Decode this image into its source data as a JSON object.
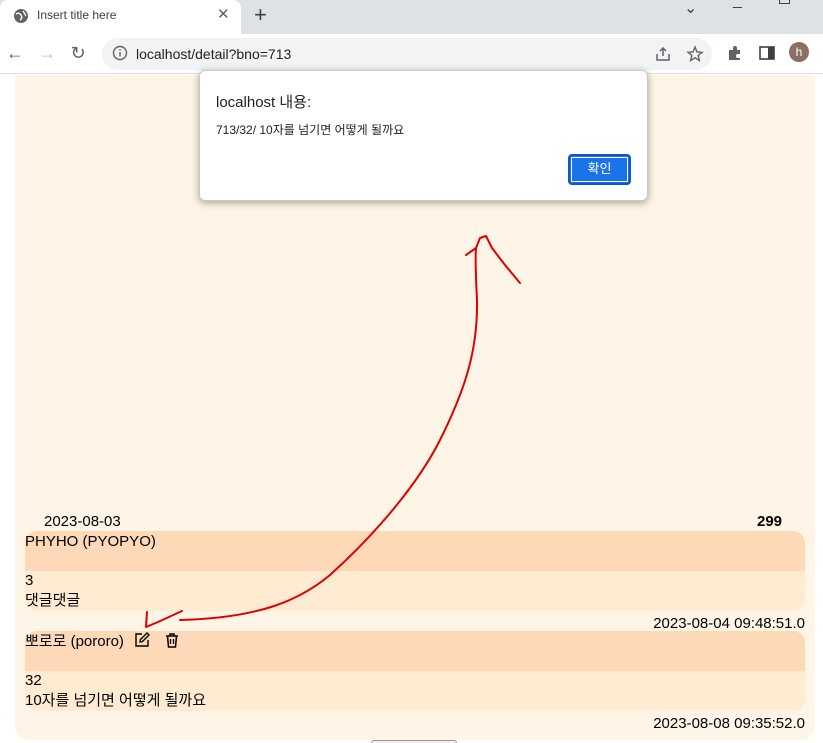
{
  "browser": {
    "tab_title": "Insert title here",
    "new_tab": "+",
    "url": "localhost/detail?bno=713",
    "avatar_letter": "h"
  },
  "dialog": {
    "title": "localhost 내용:",
    "message": "713/32/ 10자를 넘기면 어떻게 될까요",
    "ok_label": "확인"
  },
  "post": {
    "date": "2023-08-03",
    "count": "299"
  },
  "comments": [
    {
      "author": "PHYHO (PYOPYO)",
      "number": "3",
      "text": "댓글댓글",
      "datetime": "2023-08-04 09:48:51.0",
      "editable": false
    },
    {
      "author": "뽀로로 (pororo)",
      "number": "32",
      "text": "10자를 넘기면 어떻게 될까요",
      "datetime": "2023-08-08 09:35:52.0",
      "editable": true
    }
  ],
  "colors": {
    "page_bg": "#fff5e6",
    "comment_head": "#fed9b7",
    "comment_body": "#ffebd1",
    "dialog_button": "#1a73e8",
    "annotation": "#e00000"
  }
}
